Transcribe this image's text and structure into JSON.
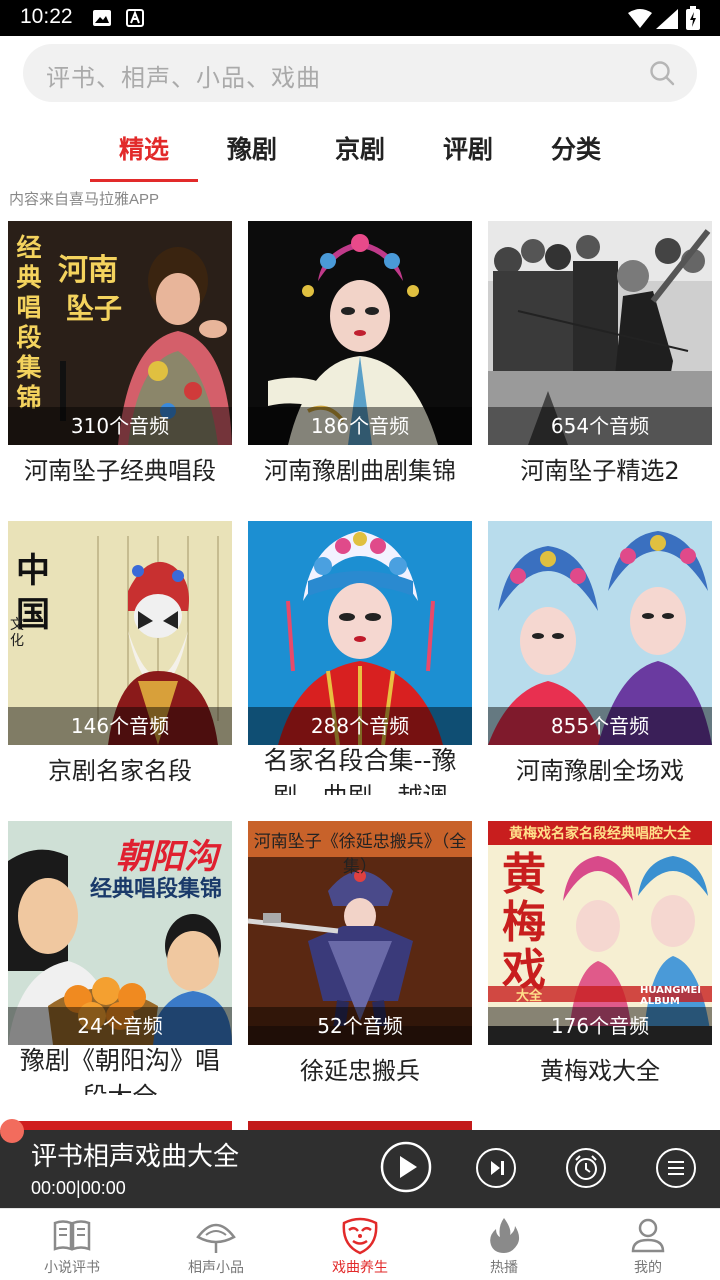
{
  "status_bar": {
    "time": "10:22"
  },
  "search": {
    "placeholder": "评书、相声、小品、戏曲"
  },
  "tabs": [
    {
      "label": "精选",
      "active": true
    },
    {
      "label": "豫剧",
      "active": false
    },
    {
      "label": "京剧",
      "active": false
    },
    {
      "label": "评剧",
      "active": false
    },
    {
      "label": "分类",
      "active": false
    }
  ],
  "source_note": "内容来自喜马拉雅APP",
  "albums": [
    {
      "count": "310个音频",
      "title": "河南坠子经典唱段"
    },
    {
      "count": "186个音频",
      "title": "河南豫剧曲剧集锦"
    },
    {
      "count": "654个音频",
      "title": "河南坠子精选2"
    },
    {
      "count": "146个音频",
      "title": "京剧名家名段"
    },
    {
      "count": "288个音频",
      "title": "名家名段合集--豫剧、曲剧、越调"
    },
    {
      "count": "855个音频",
      "title": "河南豫剧全场戏"
    },
    {
      "count": "24个音频",
      "title": "豫剧《朝阳沟》唱段大全"
    },
    {
      "count": "52个音频",
      "title": "徐延忠搬兵"
    },
    {
      "count": "176个音频",
      "title": "黄梅戏大全"
    }
  ],
  "thumb_texts": {
    "a1_vertical": "经典唱段集锦",
    "a1_horizontal": "河南",
    "a1_horizontal2": "坠子",
    "a4_calligraphy": "中国",
    "a4_small": "文化",
    "a7_title": "朝阳沟",
    "a7_sub": "经典唱段集锦",
    "a8_banner": "河南坠子《徐延忠搬兵》（全集）",
    "a9_banner": "黄梅戏名家名段经典唱腔大全",
    "a9_big": "黄梅戏",
    "a9_tag": "大全",
    "a9_album": "HUANGMEI ALBUM"
  },
  "player": {
    "title": "评书相声戏曲大全",
    "time": "00:00|00:00"
  },
  "bottom_nav": [
    {
      "label": "小说评书",
      "icon": "book-icon",
      "active": false
    },
    {
      "label": "相声小品",
      "icon": "fan-icon",
      "active": false
    },
    {
      "label": "戏曲养生",
      "icon": "opera-mask-icon",
      "active": true
    },
    {
      "label": "热播",
      "icon": "flame-icon",
      "active": false
    },
    {
      "label": "我的",
      "icon": "user-icon",
      "active": false
    }
  ],
  "colors": {
    "accent": "#e22a2a",
    "player_bg": "#2f2f2f",
    "search_bg": "#f1f1f1"
  }
}
